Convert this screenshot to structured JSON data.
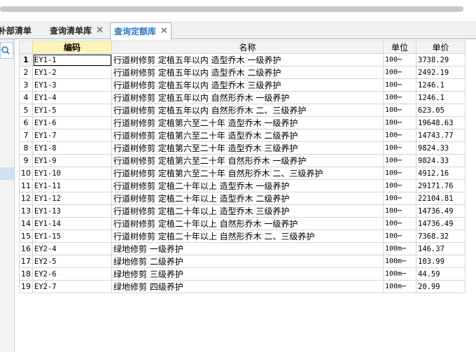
{
  "tabs": [
    {
      "label": "补部清单",
      "active": false
    },
    {
      "label": "查询清单库",
      "active": false
    },
    {
      "label": "查询定额库",
      "active": true
    }
  ],
  "close_glyph": "✕",
  "columns": {
    "code": "编码",
    "name": "名称",
    "unit": "单位",
    "price": "单价"
  },
  "rows": [
    {
      "idx": "1",
      "code": "EY1-1",
      "name": "行道树修剪 定植五年以内 造型乔木 一级养护",
      "unit": "100⋯",
      "price": "3738.29"
    },
    {
      "idx": "2",
      "code": "EY1-2",
      "name": "行道树修剪 定植五年以内 造型乔木 二级养护",
      "unit": "100⋯",
      "price": "2492.19"
    },
    {
      "idx": "3",
      "code": "EY1-3",
      "name": "行道树修剪 定植五年以内 造型乔木 三级养护",
      "unit": "100⋯",
      "price": "1246.1"
    },
    {
      "idx": "4",
      "code": "EY1-4",
      "name": "行道树修剪 定植五年以内 自然形乔木 一级养护",
      "unit": "100⋯",
      "price": "1246.1"
    },
    {
      "idx": "5",
      "code": "EY1-5",
      "name": "行道树修剪 定植五年以内 自然形乔木 二、三级养护",
      "unit": "100⋯",
      "price": "623.05"
    },
    {
      "idx": "6",
      "code": "EY1-6",
      "name": "行道树修剪 定植第六至二十年 造型乔木 一级养护",
      "unit": "100⋯",
      "price": "19648.63"
    },
    {
      "idx": "7",
      "code": "EY1-7",
      "name": "行道树修剪 定植第六至二十年 造型乔木 二级养护",
      "unit": "100⋯",
      "price": "14743.77"
    },
    {
      "idx": "8",
      "code": "EY1-8",
      "name": "行道树修剪 定植第六至二十年 造型乔木 三级养护",
      "unit": "100⋯",
      "price": "9824.33"
    },
    {
      "idx": "9",
      "code": "EY1-9",
      "name": "行道树修剪 定植第六至二十年 自然形乔木 一级养护",
      "unit": "100⋯",
      "price": "9824.33"
    },
    {
      "idx": "10",
      "code": "EY1-10",
      "name": "行道树修剪 定植第六至二十年 自然形乔木 二、三级养护",
      "unit": "100⋯",
      "price": "4912.16"
    },
    {
      "idx": "11",
      "code": "EY1-11",
      "name": "行道树修剪 定植二十年以上 造型乔木 一级养护",
      "unit": "100⋯",
      "price": "29171.76"
    },
    {
      "idx": "12",
      "code": "EY1-12",
      "name": "行道树修剪 定植二十年以上 造型乔木 二级养护",
      "unit": "100⋯",
      "price": "22104.81"
    },
    {
      "idx": "13",
      "code": "EY1-13",
      "name": "行道树修剪 定植二十年以上 造型乔木 三级养护",
      "unit": "100⋯",
      "price": "14736.49"
    },
    {
      "idx": "14",
      "code": "EY1-14",
      "name": "行道树修剪 定植二十年以上 自然形乔木 一级养护",
      "unit": "100⋯",
      "price": "14736.49"
    },
    {
      "idx": "15",
      "code": "EY1-15",
      "name": "行道树修剪 定植二十年以上 自然形乔木 二、三级养护",
      "unit": "100⋯",
      "price": "7368.32"
    },
    {
      "idx": "16",
      "code": "EY2-4",
      "name": "绿地修剪 一级养护",
      "unit": "100m⋯",
      "price": "146.37"
    },
    {
      "idx": "17",
      "code": "EY2-5",
      "name": "绿地修剪 二级养护",
      "unit": "100m⋯",
      "price": "103.99"
    },
    {
      "idx": "18",
      "code": "EY2-6",
      "name": "绿地修剪 三级养护",
      "unit": "100m⋯",
      "price": "44.59"
    },
    {
      "idx": "19",
      "code": "EY2-7",
      "name": "绿地修剪 四级养护",
      "unit": "100m⋯",
      "price": "20.99"
    }
  ],
  "colors": {
    "tab_active_text": "#2a78c8",
    "code_header_bg": "#fff4b8",
    "selection": "#cfe0f5"
  },
  "icons": {
    "search": "search-icon",
    "close": "close-icon"
  }
}
